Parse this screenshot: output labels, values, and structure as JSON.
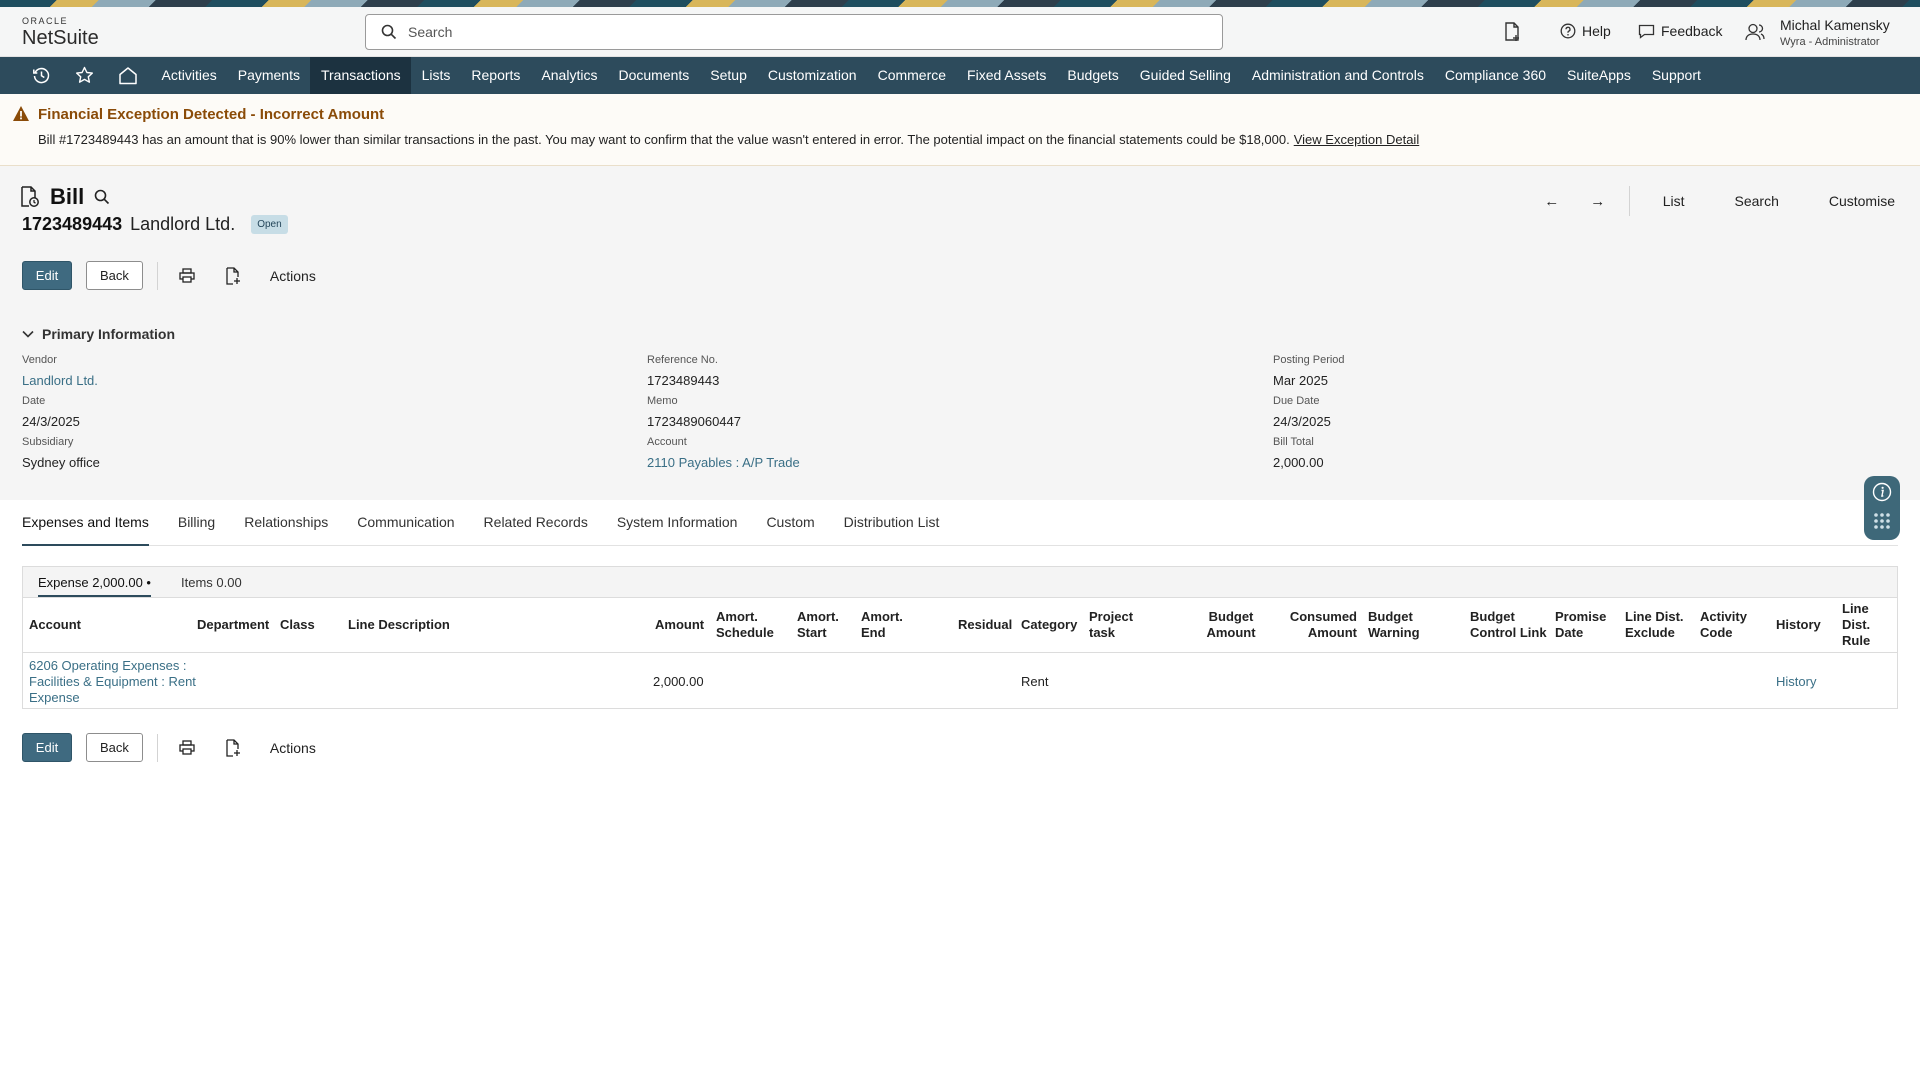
{
  "header": {
    "logo_top": "ORACLE",
    "logo_main": "NetSuite",
    "search_placeholder": "Search",
    "help": "Help",
    "feedback": "Feedback",
    "user_name": "Michal Kamensky",
    "user_role": "Wyra - Administrator"
  },
  "nav": {
    "items": [
      "Activities",
      "Payments",
      "Transactions",
      "Lists",
      "Reports",
      "Analytics",
      "Documents",
      "Setup",
      "Customization",
      "Commerce",
      "Fixed Assets",
      "Budgets",
      "Guided Selling",
      "Administration and Controls",
      "Compliance 360",
      "SuiteApps",
      "Support"
    ],
    "active": "Transactions"
  },
  "alert": {
    "title": "Financial Exception Detected - Incorrect Amount",
    "message": "Bill #1723489443 has an amount that is 90% lower than similar transactions in the past. You may want to confirm that the value wasn't entered in error. The potential impact on the financial statements could be $18,000.",
    "link": "View Exception Detail"
  },
  "record": {
    "type": "Bill",
    "number": "1723489443",
    "vendor_name": "Landlord Ltd.",
    "status": "Open",
    "nav": {
      "list": "List",
      "search": "Search",
      "customise": "Customise"
    },
    "toolbar": {
      "edit": "Edit",
      "back": "Back",
      "actions": "Actions"
    },
    "section_title": "Primary Information",
    "fields": {
      "col1": [
        {
          "label": "Vendor",
          "value": "Landlord Ltd.",
          "link": true
        },
        {
          "label": "Date",
          "value": "24/3/2025",
          "link": false
        },
        {
          "label": "Subsidiary",
          "value": "Sydney office",
          "link": false
        }
      ],
      "col2": [
        {
          "label": "Reference No.",
          "value": "1723489443",
          "link": false
        },
        {
          "label": "Memo",
          "value": "1723489060447",
          "link": false
        },
        {
          "label": "Account",
          "value": "2110 Payables : A/P Trade",
          "link": true
        }
      ],
      "col3": [
        {
          "label": "Posting Period",
          "value": "Mar 2025",
          "link": false
        },
        {
          "label": "Due Date",
          "value": "24/3/2025",
          "link": false
        },
        {
          "label": "Bill Total",
          "value": "2,000.00",
          "link": false
        }
      ]
    }
  },
  "subtabs": [
    "Expenses and Items",
    "Billing",
    "Relationships",
    "Communication",
    "Related Records",
    "System Information",
    "Custom",
    "Distribution List"
  ],
  "panel": {
    "tabs": [
      "Expense 2,000.00 •",
      "Items 0.00"
    ],
    "columns": {
      "account": "Account",
      "department": "Department",
      "class": "Class",
      "line_description": "Line Description",
      "amount": "Amount",
      "amort_schedule": "Amort. Schedule",
      "amort_start": "Amort. Start",
      "amort_end": "Amort. End",
      "residual": "Residual",
      "category": "Category",
      "project_task": "Project task",
      "budget_amount": "Budget Amount",
      "consumed_amount": "Consumed Amount",
      "budget_warning": "Budget Warning",
      "budget_control_link": "Budget Control Link",
      "promise_date": "Promise Date",
      "line_dist_exclude": "Line Dist. Exclude",
      "activity_code": "Activity Code",
      "history": "History",
      "line_dist_rule": "Line Dist. Rule"
    },
    "row": {
      "account": "6206 Operating Expenses : Facilities & Equipment : Rent Expense",
      "amount": "2,000.00",
      "category": "Rent",
      "history": "History"
    }
  },
  "colors": {
    "nav_bg": "#2d4b5c",
    "nav_active": "#1c3240",
    "primary_button": "#3f6a80",
    "link": "#3a6f86",
    "warning": "#8a4b08"
  },
  "icons": [
    "search-icon",
    "new-document-icon",
    "help-icon",
    "feedback-icon",
    "user-icon",
    "recent-icon",
    "star-icon",
    "home-icon",
    "warning-icon",
    "bill-record-icon",
    "magnifier-icon",
    "print-icon",
    "document-icon",
    "chevron-down-icon",
    "info-icon",
    "grid-icon"
  ]
}
